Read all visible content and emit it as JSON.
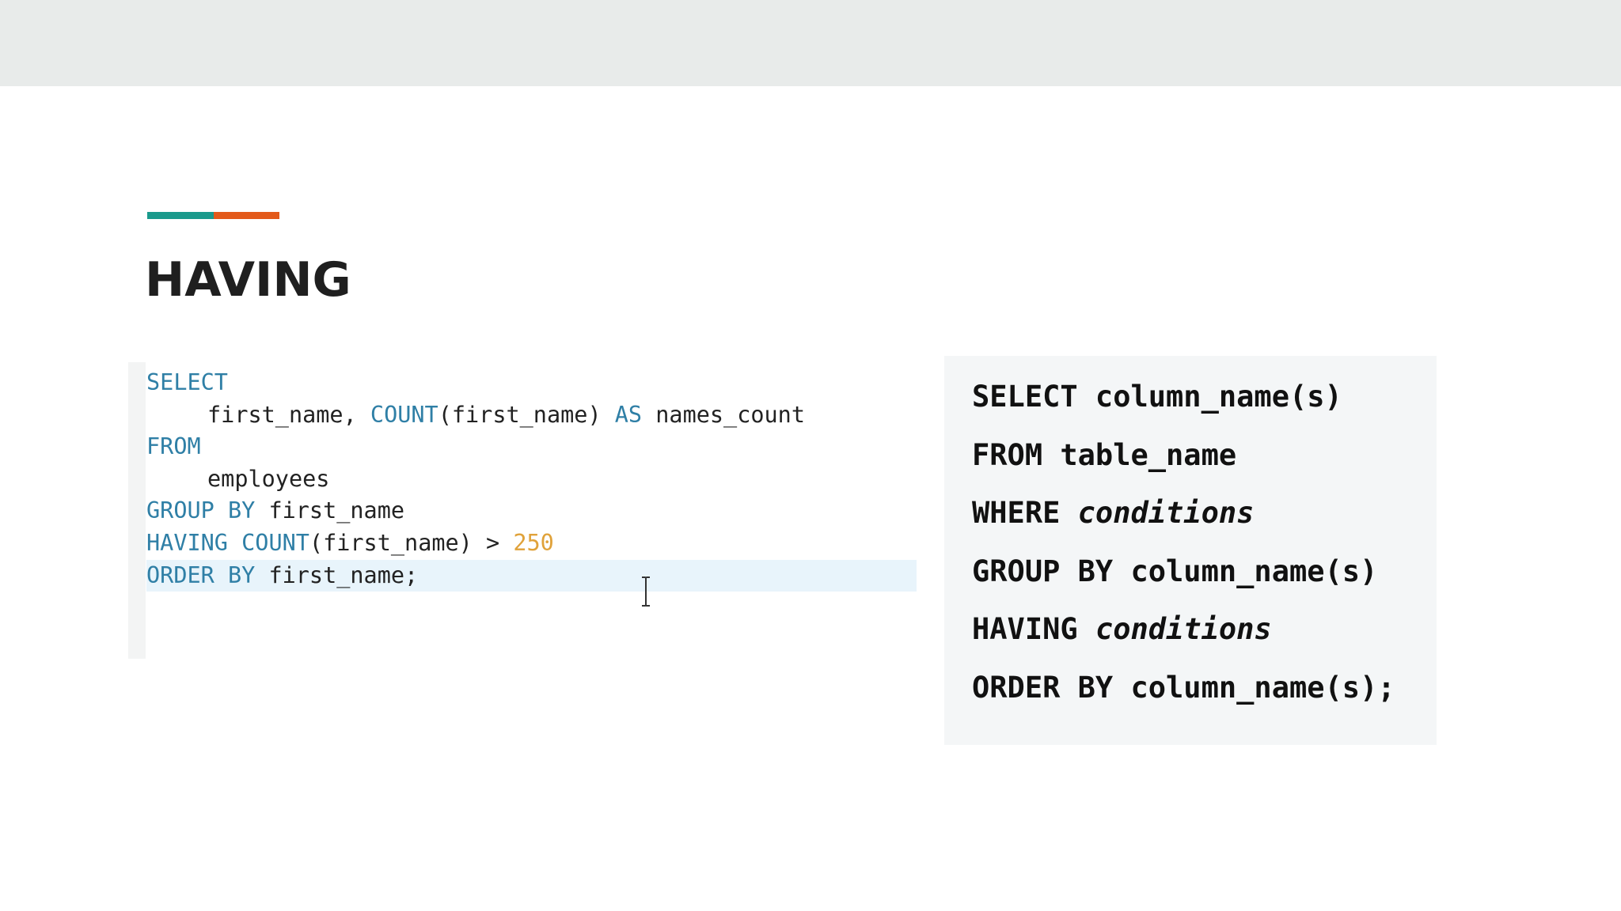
{
  "colors": {
    "accent_teal": "#1a9a8c",
    "accent_orange": "#e35a1a",
    "keyword_blue": "#2f7fa6",
    "number_orange": "#e0a23a",
    "current_line_highlight": "#e8f4fb"
  },
  "slide": {
    "title": "HAVING"
  },
  "code_editor": {
    "lines": [
      {
        "kw1": "SELECT"
      },
      {
        "t1": "first_name, ",
        "kw1": "COUNT",
        "t2": "(first_name) ",
        "kw2": "AS",
        "t3": " names_count"
      },
      {
        "kw1": "FROM"
      },
      {
        "t1": "employees"
      },
      {
        "kw1": "GROUP BY",
        "t1": " first_name"
      },
      {
        "kw1": "HAVING",
        "t0": " ",
        "kw2": "COUNT",
        "t1": "(first_name) > ",
        "num": "250"
      },
      {
        "kw1": "ORDER BY",
        "t1": " first_name;"
      }
    ],
    "cursor_icon": "text-cursor-icon"
  },
  "syntax_reference": {
    "line1": {
      "text": "SELECT column_name(s)"
    },
    "line2": {
      "text": "FROM table_name"
    },
    "line3": {
      "keyword": "WHERE ",
      "italic": "conditions"
    },
    "line4": {
      "text": "GROUP BY column_name(s)"
    },
    "line5": {
      "keyword": "HAVING ",
      "italic": "conditions"
    },
    "line6": {
      "text": "ORDER BY column_name(s);"
    }
  }
}
